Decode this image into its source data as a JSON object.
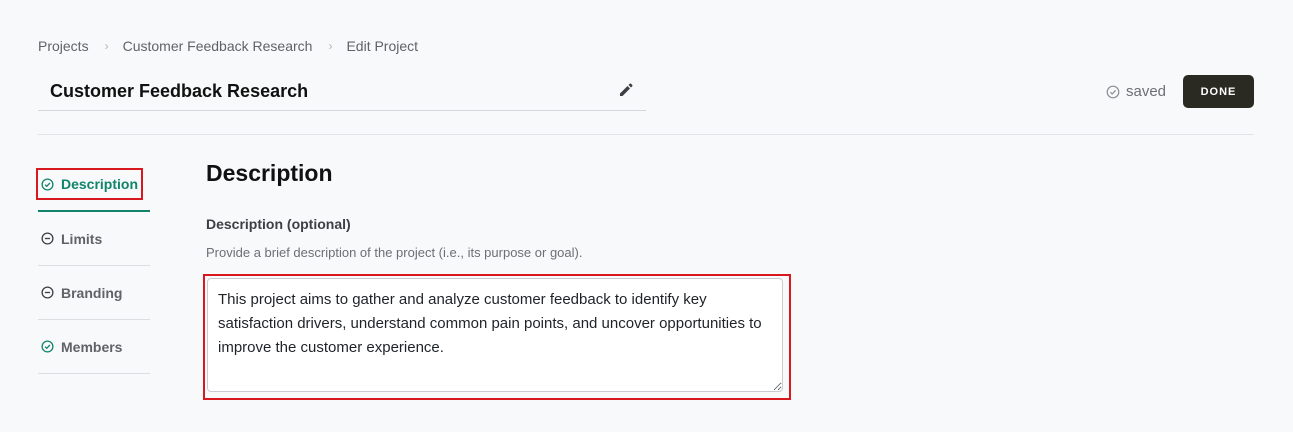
{
  "breadcrumb": {
    "items": [
      "Projects",
      "Customer Feedback Research",
      "Edit Project"
    ],
    "separator": "›"
  },
  "project": {
    "title": "Customer Feedback Research"
  },
  "header": {
    "status": "saved",
    "done_label": "DONE"
  },
  "nav": {
    "items": [
      {
        "label": "Description",
        "icon": "check-circle-icon",
        "state": "active"
      },
      {
        "label": "Limits",
        "icon": "minus-circle-icon",
        "state": "incomplete"
      },
      {
        "label": "Branding",
        "icon": "minus-circle-icon",
        "state": "incomplete"
      },
      {
        "label": "Members",
        "icon": "check-circle-icon",
        "state": "complete"
      }
    ]
  },
  "main": {
    "section_title": "Description",
    "field_label": "Description (optional)",
    "field_help": "Provide a brief description of the project (i.e., its purpose or goal).",
    "field_value": "This project aims to gather and analyze customer feedback to identify key satisfaction drivers, understand common pain points, and uncover opportunities to improve the customer experience."
  },
  "colors": {
    "accent_green": "#11846b",
    "done_button_bg": "#2b2a22",
    "highlight_red": "#d7191f"
  }
}
